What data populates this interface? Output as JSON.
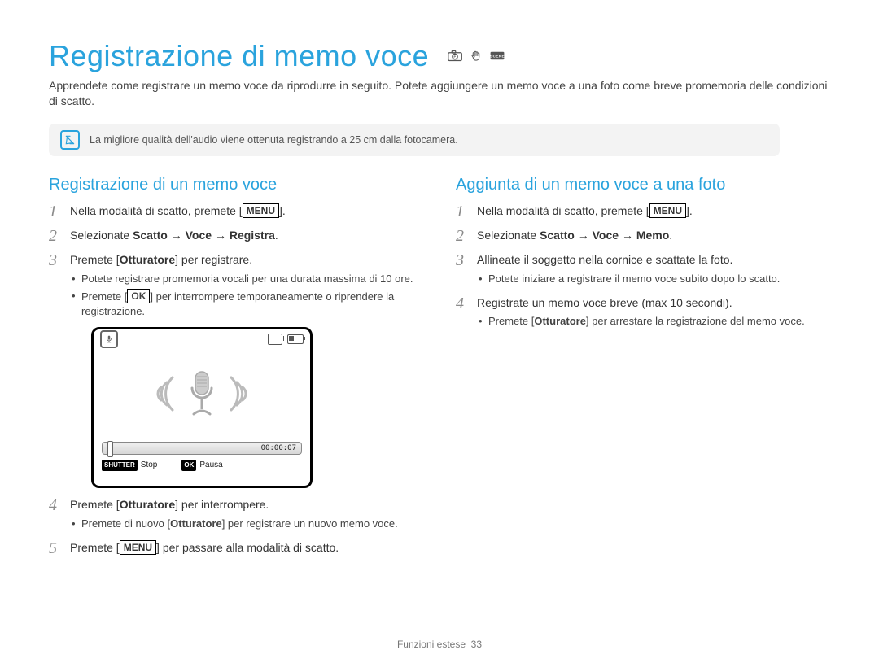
{
  "title": "Registrazione di memo voce",
  "intro": "Apprendete come registrare un memo voce da riprodurre in seguito. Potete aggiungere un memo voce a una foto come breve promemoria delle condizioni di scatto.",
  "note": "La migliore qualità dell'audio viene ottenuta registrando a 25 cm dalla fotocamera.",
  "left": {
    "heading": "Registrazione di un memo voce",
    "s1_pre": "Nella modalità di scatto, premete [",
    "s1_btn": "MENU",
    "s1_post": "].",
    "s2_a": "Selezionate ",
    "s2_b": "Scatto → Voce → Registra",
    "s2_c": ".",
    "s3_a": "Premete [",
    "s3_b": "Otturatore",
    "s3_c": "] per registrare.",
    "s3_sub1": "Potete registrare promemoria vocali per una durata massima di 10 ore.",
    "s3_sub2_a": "Premete [",
    "s3_sub2_btn": "OK",
    "s3_sub2_b": "] per interrompere temporaneamente o riprendere la registrazione.",
    "screen_time": "00:00:07",
    "screen_shutter_tag": "SHUTTER",
    "screen_stop": "Stop",
    "screen_ok_tag": "OK",
    "screen_pause": "Pausa",
    "s4_a": "Premete [",
    "s4_b": "Otturatore",
    "s4_c": "] per interrompere.",
    "s4_sub_a": "Premete di nuovo [",
    "s4_sub_b": "Otturatore",
    "s4_sub_c": "] per registrare un nuovo memo voce.",
    "s5_a": "Premete [",
    "s5_btn": "MENU",
    "s5_b": "] per passare alla modalità di scatto."
  },
  "right": {
    "heading": "Aggiunta di un memo voce a una foto",
    "s1_pre": "Nella modalità di scatto, premete [",
    "s1_btn": "MENU",
    "s1_post": "].",
    "s2_a": "Selezionate ",
    "s2_b": "Scatto → Voce → Memo",
    "s2_c": ".",
    "s3": "Allineate il soggetto nella cornice e scattate la foto.",
    "s3_sub": "Potete iniziare a registrare il memo voce subito dopo lo scatto.",
    "s4": "Registrate un memo voce breve (max 10 secondi).",
    "s4_sub_a": "Premete [",
    "s4_sub_b": "Otturatore",
    "s4_sub_c": "] per arrestare la registrazione del memo voce."
  },
  "footer_label": "Funzioni estese",
  "footer_page": "33"
}
